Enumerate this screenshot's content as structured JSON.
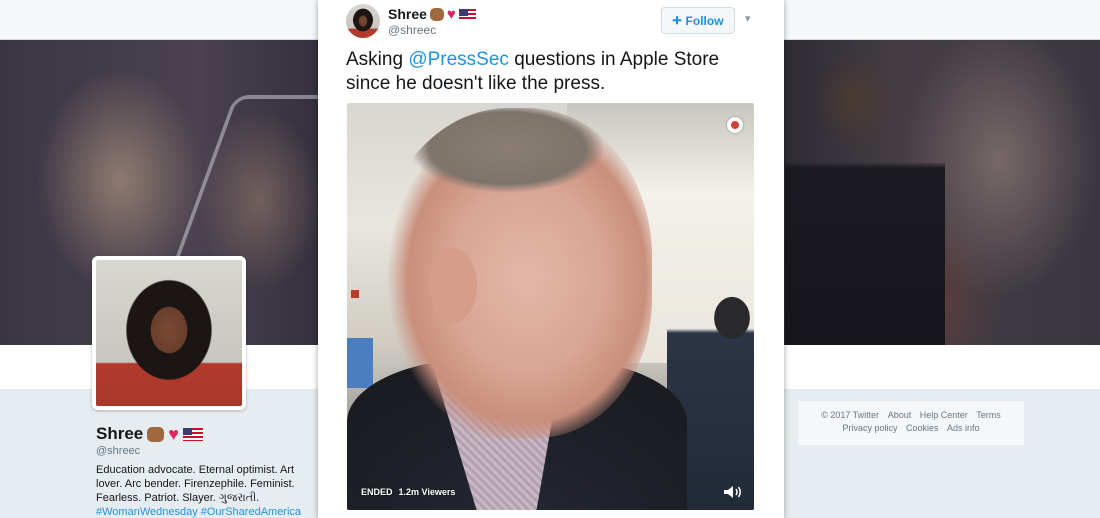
{
  "profile": {
    "name": "Shree",
    "handle": "@shreec",
    "bio": "Education advocate. Eternal optimist. Art lover. Arc bender. Firenzephile. Feminist. Fearless. Patriot. Slayer. ગુજરાતી.",
    "hashtags": "#WomanWednesday #OurSharedAmerica",
    "emoji": [
      "fist-medium-skin-icon",
      "heart-icon",
      "us-flag-icon"
    ]
  },
  "tweet": {
    "author_name": "Shree",
    "author_handle": "@shreec",
    "follow_label": "Follow",
    "text_before": "Asking ",
    "mention": "@PressSec",
    "text_after": " questions in Apple Store since he doesn't like the press.",
    "video": {
      "status": "ENDED",
      "viewers": "1.2m Viewers"
    }
  },
  "footer": {
    "items": [
      "© 2017 Twitter",
      "About",
      "Help Center",
      "Terms",
      "Privacy policy",
      "Cookies",
      "Ads info"
    ]
  },
  "colors": {
    "link": "#1b95e0",
    "follow_text": "#1d91d6",
    "heart": "#e0245e"
  }
}
